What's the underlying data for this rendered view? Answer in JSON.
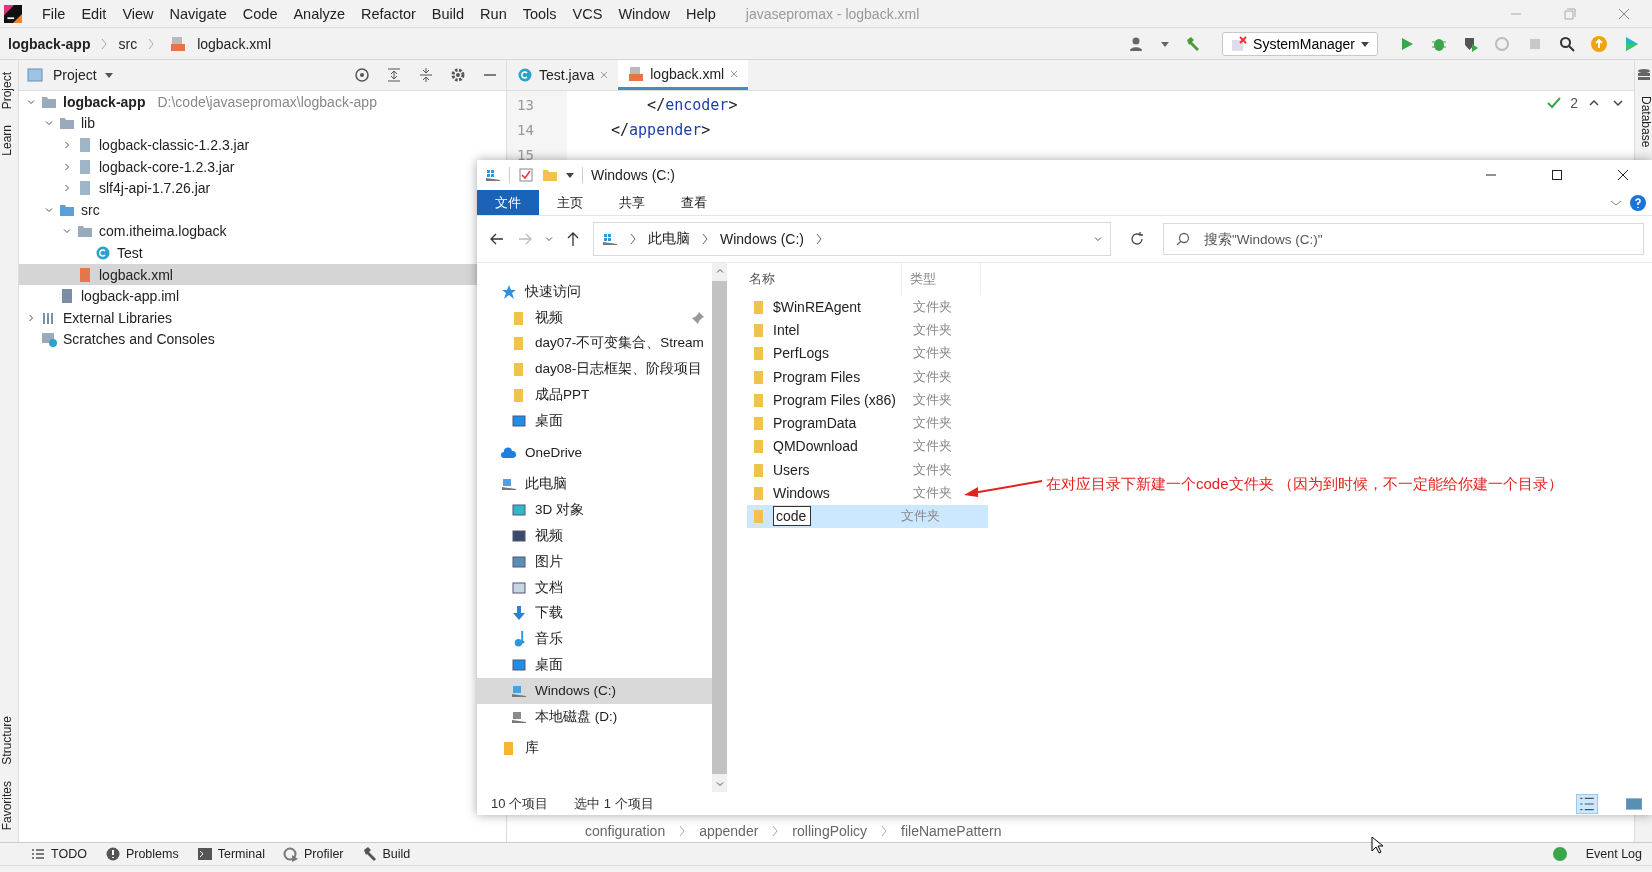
{
  "menu": [
    "File",
    "Edit",
    "View",
    "Navigate",
    "Code",
    "Analyze",
    "Refactor",
    "Build",
    "Run",
    "Tools",
    "VCS",
    "Window",
    "Help"
  ],
  "window_title": "javasepromax - logback.xml",
  "nav_bar": {
    "crumbs": [
      {
        "label": "logback-app",
        "kind": "project"
      },
      {
        "label": "src",
        "kind": "plain"
      },
      {
        "label": "logback.xml",
        "kind": "xml"
      }
    ],
    "run_config": "SystemManager"
  },
  "left_strip": [
    {
      "label": "Project",
      "kind": "top"
    },
    {
      "label": "Learn",
      "kind": "top"
    },
    {
      "label": "Structure",
      "kind": "bottom"
    },
    {
      "label": "Favorites",
      "kind": "bottom"
    }
  ],
  "right_strip": [
    {
      "label": "Database"
    }
  ],
  "project_panel": {
    "title": "Project",
    "tree": [
      {
        "label": "logback-app",
        "hint": "D:\\code\\javasepromax\\logback-app",
        "kind": "module",
        "expanded": true,
        "selected": false,
        "children": [
          {
            "label": "lib",
            "kind": "folder",
            "expanded": true,
            "selected": false,
            "children": [
              {
                "label": "logback-classic-1.2.3.jar",
                "kind": "jar",
                "expanded": false,
                "selected": false
              },
              {
                "label": "logback-core-1.2.3.jar",
                "kind": "jar",
                "expanded": false,
                "selected": false
              },
              {
                "label": "slf4j-api-1.7.26.jar",
                "kind": "jar",
                "expanded": false,
                "selected": false
              }
            ]
          },
          {
            "label": "src",
            "kind": "source",
            "expanded": true,
            "selected": false,
            "children": [
              {
                "label": "com.itheima.logback",
                "kind": "package",
                "expanded": true,
                "selected": false,
                "children": [
                  {
                    "label": "Test",
                    "kind": "class",
                    "selected": false
                  }
                ]
              },
              {
                "label": "logback.xml",
                "kind": "xml",
                "selected": true
              }
            ]
          },
          {
            "label": "logback-app.iml",
            "kind": "iml",
            "selected": false
          }
        ]
      },
      {
        "label": "External Libraries",
        "kind": "libraries",
        "expanded": false,
        "selected": false
      },
      {
        "label": "Scratches and Consoles",
        "kind": "scratches",
        "selected": false
      }
    ]
  },
  "editor": {
    "tabs": [
      {
        "label": "Test.java",
        "kind": "class",
        "selected": false
      },
      {
        "label": "logback.xml",
        "kind": "xml",
        "selected": true
      }
    ],
    "lines": [
      {
        "number": "13",
        "code": "    </encoder>"
      },
      {
        "number": "14",
        "code": "</appender>"
      },
      {
        "number": "15"
      }
    ],
    "inspection_count": "2",
    "breadcrumb": [
      "configuration",
      "appender",
      "rollingPolicy",
      "fileNamePattern"
    ]
  },
  "explorer": {
    "title": "Windows (C:)",
    "ribbon_tabs": [
      {
        "label": "文件",
        "selected": true
      },
      {
        "label": "主页",
        "selected": false
      },
      {
        "label": "共享",
        "selected": false
      },
      {
        "label": "查看",
        "selected": false
      }
    ],
    "address": [
      "此电脑",
      "Windows (C:)"
    ],
    "search": {
      "placeholder": "搜索\"Windows (C:)\""
    },
    "nav": [
      {
        "label": "快速访问",
        "kind": "star",
        "selected": false,
        "children": [
          {
            "label": "视频",
            "kind": "folder",
            "pinned": true,
            "selected": false
          },
          {
            "label": "day07-不可变集合、Stream",
            "kind": "folder",
            "pinned": false,
            "selected": false
          },
          {
            "label": "day08-日志框架、阶段项目",
            "kind": "folder",
            "pinned": false,
            "selected": false
          },
          {
            "label": "成品PPT",
            "kind": "folder",
            "pinned": false,
            "selected": false
          },
          {
            "label": "桌面",
            "kind": "desktop",
            "pinned": false,
            "selected": false
          }
        ]
      },
      {
        "label": "OneDrive",
        "kind": "cloud",
        "selected": false
      },
      {
        "label": "此电脑",
        "kind": "pc",
        "selected": false,
        "children": [
          {
            "label": "3D 对象",
            "kind": "cube",
            "selected": false
          },
          {
            "label": "视频",
            "kind": "video",
            "selected": false
          },
          {
            "label": "图片",
            "kind": "picture",
            "selected": false
          },
          {
            "label": "文档",
            "kind": "document",
            "selected": false
          },
          {
            "label": "下载",
            "kind": "download",
            "selected": false
          },
          {
            "label": "音乐",
            "kind": "music",
            "selected": false
          },
          {
            "label": "桌面",
            "kind": "desktop",
            "selected": false
          },
          {
            "label": "Windows (C:)",
            "kind": "windrive",
            "selected": true
          },
          {
            "label": "本地磁盘 (D:)",
            "kind": "drive",
            "selected": false
          }
        ]
      },
      {
        "label": "库",
        "kind": "library",
        "selected": false
      }
    ],
    "columns": [
      "名称",
      "类型"
    ],
    "rows": [
      {
        "name": "$WinREAgent",
        "type": "文件夹",
        "selected": false,
        "editing": false
      },
      {
        "name": "Intel",
        "type": "文件夹",
        "selected": false,
        "editing": false
      },
      {
        "name": "PerfLogs",
        "type": "文件夹",
        "selected": false,
        "editing": false
      },
      {
        "name": "Program Files",
        "type": "文件夹",
        "selected": false,
        "editing": false
      },
      {
        "name": "Program Files (x86)",
        "type": "文件夹",
        "selected": false,
        "editing": false
      },
      {
        "name": "ProgramData",
        "type": "文件夹",
        "selected": false,
        "editing": false
      },
      {
        "name": "QMDownload",
        "type": "文件夹",
        "selected": false,
        "editing": false
      },
      {
        "name": "Users",
        "type": "文件夹",
        "selected": false,
        "editing": false
      },
      {
        "name": "Windows",
        "type": "文件夹",
        "selected": false,
        "editing": false
      },
      {
        "name": "code",
        "type": "文件夹",
        "selected": true,
        "editing": true
      }
    ],
    "status": [
      "10 个项目",
      "选中 1 个项目"
    ]
  },
  "annotation": "在对应目录下新建一个code文件夹 （因为到时候，不一定能给你建一个目录）",
  "tool_windows": [
    {
      "label": "TODO",
      "kind": "list"
    },
    {
      "label": "Problems",
      "kind": "problems"
    },
    {
      "label": "Terminal",
      "kind": "terminal"
    },
    {
      "label": "Profiler",
      "kind": "profiler"
    },
    {
      "label": "Build",
      "kind": "build"
    }
  ],
  "event_log": "Event Log"
}
